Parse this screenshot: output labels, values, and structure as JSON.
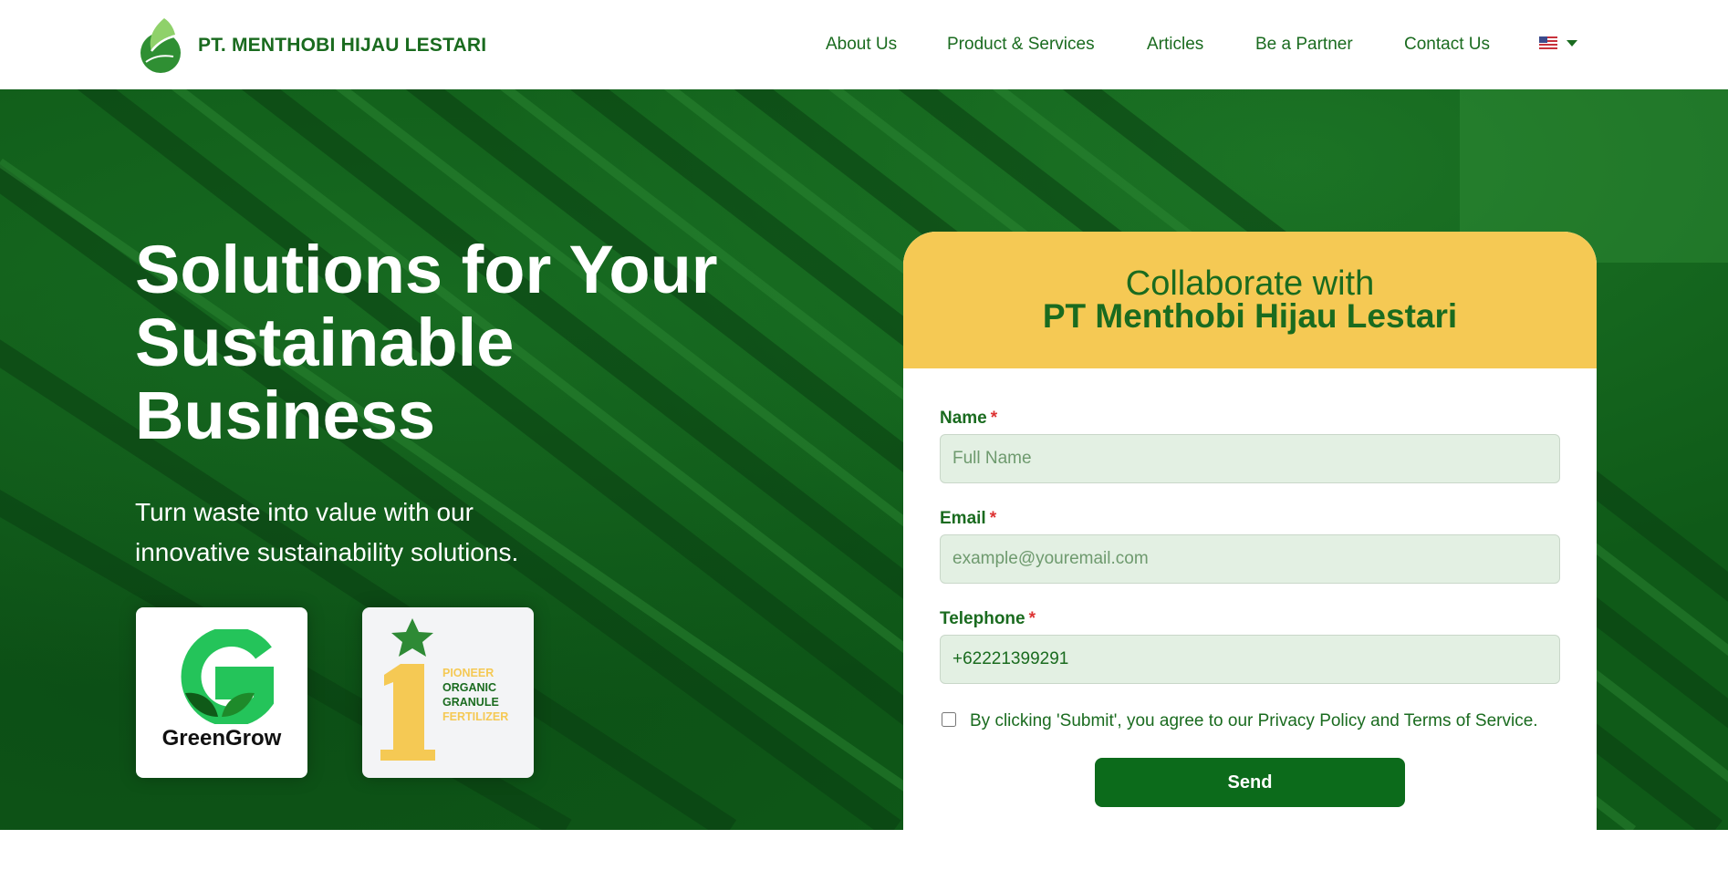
{
  "header": {
    "brand": "PT. MENTHOBI HIJAU LESTARI",
    "nav": [
      "About Us",
      "Product & Services",
      "Articles",
      "Be a Partner",
      "Contact Us"
    ],
    "language_icon": "us-flag-icon"
  },
  "hero": {
    "title_line1": "Solutions for Your",
    "title_line2": "Sustainable",
    "title_line3": "Business",
    "subtitle_line1": "Turn waste into value with our",
    "subtitle_line2": "innovative sustainability solutions.",
    "badge_greengrow": "GreenGrow",
    "badge_pioneer": [
      "PIONEER",
      "ORGANIC",
      "GRANULE",
      "FERTILIZER"
    ]
  },
  "form": {
    "heading_line1": "Collaborate with",
    "heading_line2": "PT Menthobi Hijau Lestari",
    "name_label": "Name",
    "name_placeholder": "Full Name",
    "email_label": "Email",
    "email_placeholder": "example@youremail.com",
    "phone_label": "Telephone",
    "phone_value": "+62221399291",
    "required_mark": "*",
    "consent": "By clicking 'Submit', you agree to our Privacy Policy and Terms of Service.",
    "send_label": "Send"
  },
  "colors": {
    "brand_green": "#1a6b1f",
    "button_green": "#0c6b1b",
    "form_header_yellow": "#f5c954",
    "input_bg": "#e3f0e3"
  }
}
